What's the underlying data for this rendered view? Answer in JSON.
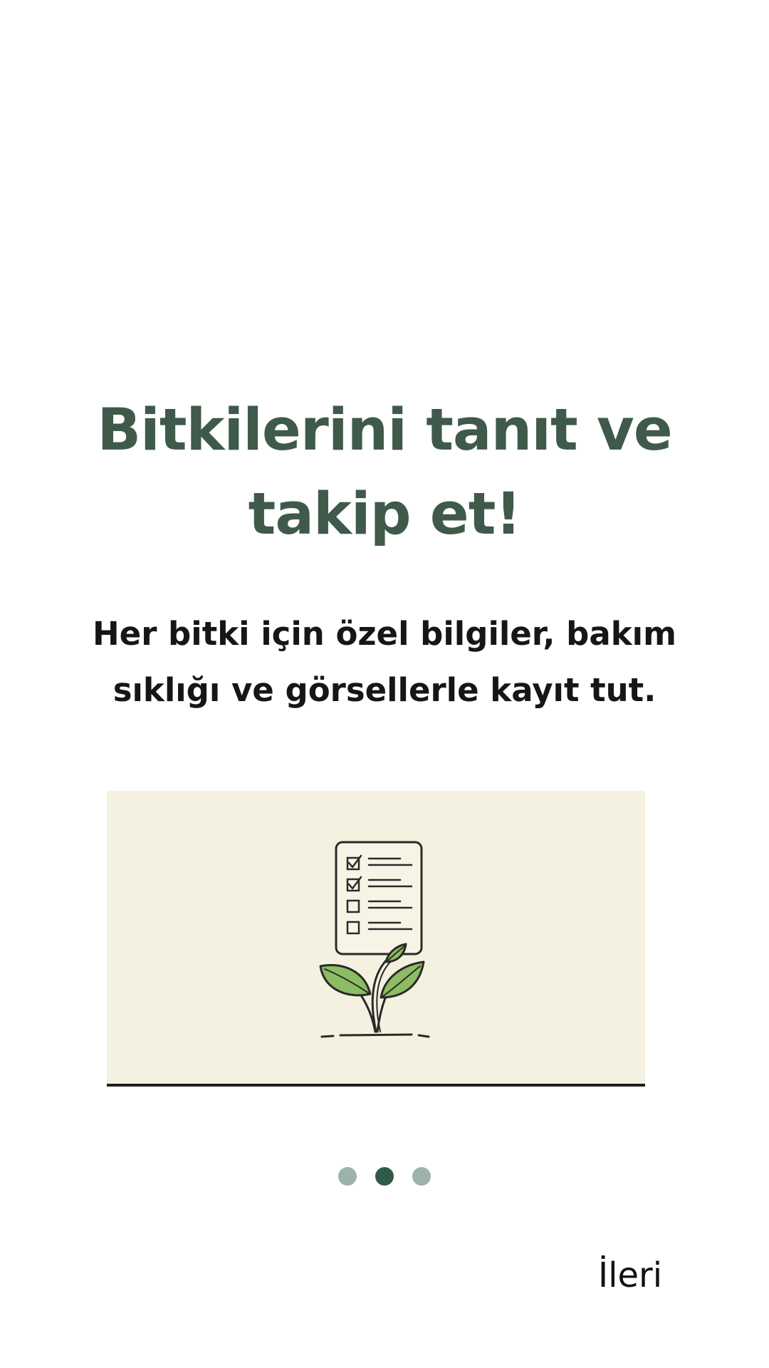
{
  "onboarding": {
    "title": "Bitkilerini tanıt ve takip et!",
    "subtitle": "Her bitki için özel bilgiler, bakım sıklığı ve görsellerle kayıt tut.",
    "illustration_icon": "checklist-sprout-icon",
    "page_indicator": {
      "total": 3,
      "current": 2
    },
    "next_label": "İleri"
  },
  "colors": {
    "title": "#3f5a4b",
    "subtitle": "#161616",
    "card_background": "#f4f1e1",
    "dot_active": "#2f5a47",
    "dot_inactive": "#9db3aa",
    "leaf": "#8dbd63",
    "outline": "#2a2a2a"
  }
}
